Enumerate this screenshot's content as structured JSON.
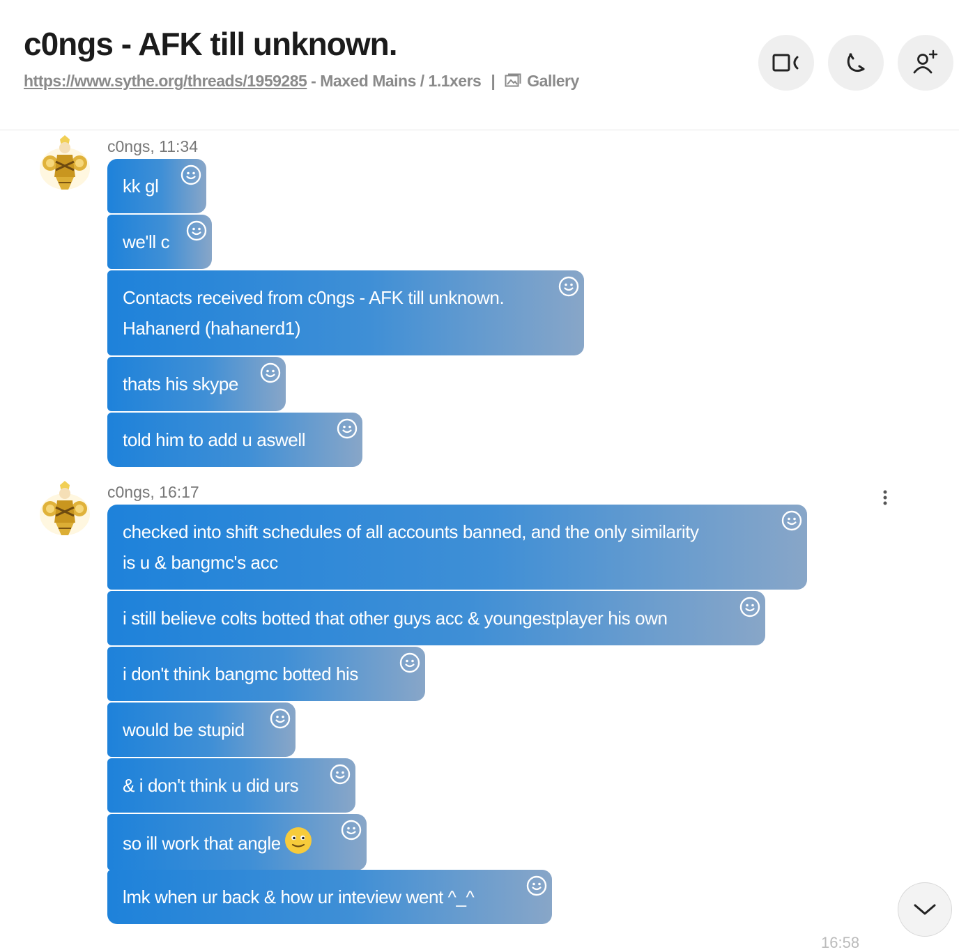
{
  "header": {
    "title": "c0ngs - AFK till unknown.",
    "link": "https://www.sythe.org/threads/1959285",
    "subtitle_rest": " - Maxed Mains / 1.1xers",
    "separator": "|",
    "gallery_label": "Gallery",
    "buttons": [
      "video-call-icon",
      "audio-call-icon",
      "add-person-icon"
    ]
  },
  "groups": [
    {
      "author": "c0ngs",
      "time": "11:34",
      "meta": "c0ngs, 11:34",
      "messages": [
        {
          "text": "kk gl"
        },
        {
          "text": "we'll c"
        },
        {
          "text": "Contacts received from c0ngs - AFK till unknown.",
          "text2": "Hahanerd (hahanerd1)"
        },
        {
          "text": "thats his skype"
        },
        {
          "text": "told him to add u aswell"
        }
      ]
    },
    {
      "author": "c0ngs",
      "time": "16:17",
      "meta": "c0ngs, 16:17",
      "messages": [
        {
          "text": "checked into shift schedules of all accounts banned, and the only similarity",
          "text2": "is u & bangmc's acc"
        },
        {
          "text": "i still believe colts botted that other guys acc & youngestplayer his own"
        },
        {
          "text": "i don't think bangmc botted his"
        },
        {
          "text": "would be stupid"
        },
        {
          "text": "& i don't think u did urs"
        },
        {
          "text": "so ill work that angle",
          "emoji": "smile-emoji"
        },
        {
          "text": "lmk when ur back & how ur inteview went ^_^"
        }
      ]
    }
  ],
  "footer": {
    "partial_time": "16:58"
  },
  "colors": {
    "bubble_start": "#1e82da",
    "bubble_end": "#88a6c8",
    "meta_text": "#777777",
    "header_button_bg": "#efefef"
  }
}
